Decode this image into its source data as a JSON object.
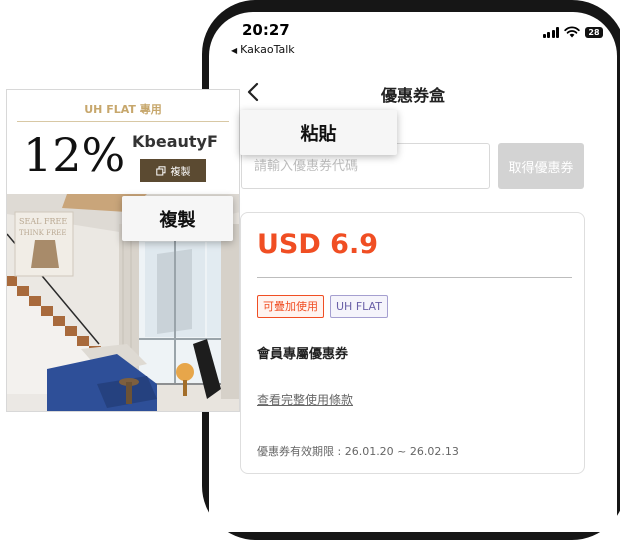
{
  "status_bar": {
    "time": "20:27",
    "app_back": "KakaoTalk",
    "battery": "28"
  },
  "header": {
    "title": "優惠券盒"
  },
  "coupon_entry": {
    "placeholder": "請輸入優惠券代碼",
    "button_label": "取得優惠券"
  },
  "coupon": {
    "amount": "USD 6.9",
    "tags": [
      "可疊加使用",
      "UH FLAT"
    ],
    "name": "會員專屬優惠券",
    "terms_link": "查看完整使用條款",
    "validity": "優惠券有效期限 : 26.01.20 ~ 26.02.13"
  },
  "tooltips": {
    "paste": "粘貼",
    "copy": "複製"
  },
  "promo": {
    "header": "UH FLAT 專用",
    "discount": "12%",
    "code": "KbeautyF",
    "copy_label": "複製",
    "poster_text": [
      "SEAL FREE",
      "THINK FREE"
    ]
  },
  "colors": {
    "accent_orange": "#f04e23",
    "tag_purple": "#6b61a8",
    "gold": "#c7a76c",
    "copy_button": "#5b4a31",
    "disabled_button": "#d3d3d3"
  },
  "icons": [
    "chevron-left-icon",
    "signal-icon",
    "wifi-icon",
    "battery-icon",
    "copy-icon"
  ]
}
